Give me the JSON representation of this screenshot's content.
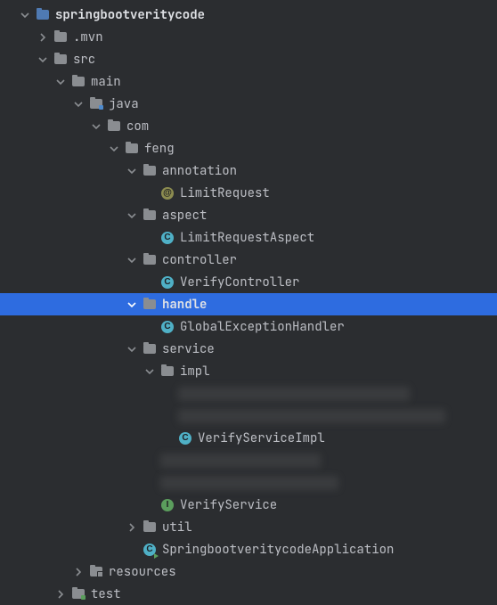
{
  "tree": {
    "root": {
      "label": "springbootveritycode"
    },
    "mvn": {
      "label": ".mvn"
    },
    "src": {
      "label": "src"
    },
    "main": {
      "label": "main"
    },
    "java": {
      "label": "java"
    },
    "com": {
      "label": "com"
    },
    "feng": {
      "label": "feng"
    },
    "annotation": {
      "label": "annotation"
    },
    "limitRequest": {
      "label": "LimitRequest"
    },
    "aspect": {
      "label": "aspect"
    },
    "limitRequestAspect": {
      "label": "LimitRequestAspect"
    },
    "controller": {
      "label": "controller"
    },
    "verifyController": {
      "label": "VerifyController"
    },
    "handle": {
      "label": "handle"
    },
    "globalExceptionHandler": {
      "label": "GlobalExceptionHandler"
    },
    "service": {
      "label": "service"
    },
    "impl": {
      "label": "impl"
    },
    "verifyServiceImpl": {
      "label": "VerifyServiceImpl"
    },
    "verifyService": {
      "label": "VerifyService"
    },
    "util": {
      "label": "util"
    },
    "application": {
      "label": "SpringbootveritycodeApplication"
    },
    "resources": {
      "label": "resources"
    },
    "test": {
      "label": "test"
    }
  }
}
